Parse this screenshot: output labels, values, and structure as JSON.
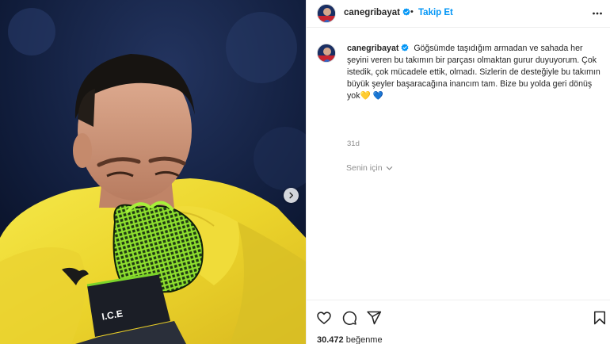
{
  "post": {
    "username": "canegribayat",
    "separator": "•",
    "follow_label": "Takip Et",
    "caption": "Göğsümde taşıdığım armadan ve sahada her şeyini veren bu takımın bir parçası olmaktan gurur duyuyorum. Çok istedik, çok mücadele ettik, olmadı. Sizlerin de desteğiyle bu takımın büyük şeyler başaracağına inancım tam. Bize bu yolda geri dönüş yok💛 💙",
    "timestamp": "31d",
    "translate_label": "Senin için",
    "likes_count": "30.472",
    "likes_label": "beğenme",
    "glove_text": "I.C.E"
  },
  "icons": {
    "verified": "verified-badge-icon",
    "more": "more-options-icon",
    "carousel": "chevron-right-icon",
    "like": "heart-icon",
    "comment": "comment-icon",
    "share": "paper-plane-icon",
    "save": "bookmark-icon",
    "translate": "chevron-down-icon"
  },
  "colors": {
    "accent": "#0095f6",
    "text": "#262626",
    "muted": "#8e8e8e",
    "border": "#efefef",
    "jersey": "#f2e23a",
    "glove": "#7cd42a",
    "background_photo": "#0d1a35"
  }
}
